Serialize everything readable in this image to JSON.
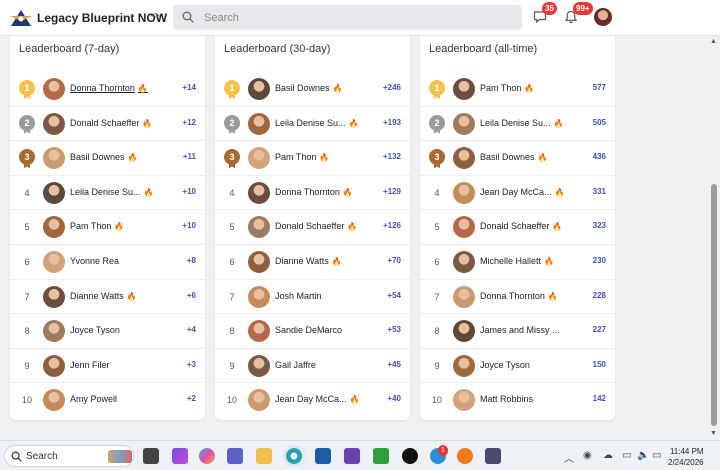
{
  "app": {
    "name": "Legacy Blueprint NOW",
    "search_placeholder": "Search",
    "messages_badge": "35",
    "notifications_badge": "99+"
  },
  "leaderboards": [
    {
      "title": "Leaderboard (7-day)",
      "rows": [
        {
          "rank": "1",
          "name": "Donna Thornton",
          "score": "+14",
          "fire": true
        },
        {
          "rank": "2",
          "name": "Donald Schaeffer",
          "score": "+12",
          "fire": true
        },
        {
          "rank": "3",
          "name": "Basil Downes",
          "score": "+11",
          "fire": true
        },
        {
          "rank": "4",
          "name": "Leila Denise Su...",
          "score": "+10",
          "fire": true
        },
        {
          "rank": "5",
          "name": "Pam Thon",
          "score": "+10",
          "fire": true
        },
        {
          "rank": "6",
          "name": "Yvonne Rea",
          "score": "+8",
          "fire": false
        },
        {
          "rank": "7",
          "name": "Dianne Watts",
          "score": "+6",
          "fire": true
        },
        {
          "rank": "8",
          "name": "Joyce Tyson",
          "score": "+4",
          "fire": false
        },
        {
          "rank": "9",
          "name": "Jenn Filer",
          "score": "+3",
          "fire": false
        },
        {
          "rank": "10",
          "name": "Amy Powell",
          "score": "+2",
          "fire": false
        }
      ]
    },
    {
      "title": "Leaderboard (30-day)",
      "rows": [
        {
          "rank": "1",
          "name": "Basil Downes",
          "score": "+246",
          "fire": true
        },
        {
          "rank": "2",
          "name": "Leila Denise Su...",
          "score": "+193",
          "fire": true
        },
        {
          "rank": "3",
          "name": "Pam Thon",
          "score": "+132",
          "fire": true
        },
        {
          "rank": "4",
          "name": "Donna Thornton",
          "score": "+129",
          "fire": true
        },
        {
          "rank": "5",
          "name": "Donald Schaeffer",
          "score": "+126",
          "fire": true
        },
        {
          "rank": "6",
          "name": "Dianne Watts",
          "score": "+70",
          "fire": true
        },
        {
          "rank": "7",
          "name": "Josh Martin",
          "score": "+54",
          "fire": false
        },
        {
          "rank": "8",
          "name": "Sandie DeMarco",
          "score": "+53",
          "fire": false
        },
        {
          "rank": "9",
          "name": "Gail Jaffre",
          "score": "+45",
          "fire": false
        },
        {
          "rank": "10",
          "name": "Jean Day McCa...",
          "score": "+40",
          "fire": true
        }
      ]
    },
    {
      "title": "Leaderboard (all-time)",
      "rows": [
        {
          "rank": "1",
          "name": "Pam Thon",
          "score": "577",
          "fire": true
        },
        {
          "rank": "2",
          "name": "Leila Denise Su...",
          "score": "505",
          "fire": true
        },
        {
          "rank": "3",
          "name": "Basil Downes",
          "score": "436",
          "fire": true
        },
        {
          "rank": "4",
          "name": "Jean Day McCa...",
          "score": "331",
          "fire": true
        },
        {
          "rank": "5",
          "name": "Donald Schaeffer",
          "score": "323",
          "fire": true
        },
        {
          "rank": "6",
          "name": "Michelle Hallett",
          "score": "230",
          "fire": true
        },
        {
          "rank": "7",
          "name": "Donna Thornton",
          "score": "228",
          "fire": true
        },
        {
          "rank": "8",
          "name": "James and Missy ...",
          "score": "227",
          "fire": false
        },
        {
          "rank": "9",
          "name": "Joyce Tyson",
          "score": "150",
          "fire": false
        },
        {
          "rank": "10",
          "name": "Matt Robbins",
          "score": "142",
          "fire": false
        }
      ]
    }
  ],
  "taskbar": {
    "search_label": "Search",
    "mail_badge": "1",
    "time": "11:44 PM",
    "date": "2/24/2026"
  },
  "colors": {
    "score": "#3f51b5",
    "gold": "#f2c14e",
    "silver": "#9a9a9a",
    "bronze": "#a86a32",
    "badge": "#e53935"
  }
}
